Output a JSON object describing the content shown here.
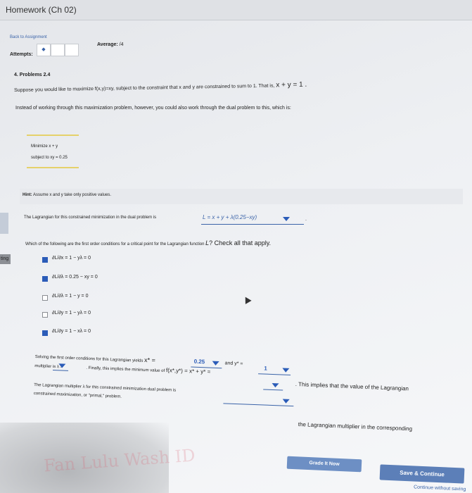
{
  "header": {
    "title": "Homework (Ch 02)"
  },
  "nav": {
    "back_link": "Back to Assignment"
  },
  "attempts": {
    "label": "Attempts:",
    "first_box": "◆"
  },
  "average": {
    "label": "Average:",
    "value": "/4"
  },
  "problem": {
    "number_label": "4. Problems 2.4",
    "statement_pre": "Suppose you would like to maximize f(x,y)=xy, subject to the constraint that x and y are constrained to sum to 1. That is,",
    "statement_eq": "x + y = 1 .",
    "dual_intro": "Instead of working through this maximization problem, however, you could also work through the dual problem to this, which is:"
  },
  "dual_box": {
    "line1": "Minimize x + y",
    "line2": "subject to xy = 0.25"
  },
  "hint": {
    "label": "Hint:",
    "text": "Assume x and y take only positive values."
  },
  "lagrangian": {
    "prompt": "The Lagrangian for this constrained minimization in the dual problem is",
    "selected": "L = x + y + λ(0.25−xy)",
    "suffix": "."
  },
  "foc": {
    "question_pre": "Which of the following are the first order conditions for a critical point for the Lagrangian function",
    "question_fn": "L",
    "question_post": "? Check all that apply.",
    "options": [
      {
        "text": "∂L/∂x = 1 − yλ = 0",
        "checked": true
      },
      {
        "text": "∂L/∂λ = 0.25 − xy = 0",
        "checked": true
      },
      {
        "text": "∂L/∂λ = 1 − y = 0",
        "checked": false
      },
      {
        "text": "∂L/∂y = 1 − yλ = 0",
        "checked": false
      },
      {
        "text": "∂L/∂y = 1 − xλ = 0",
        "checked": true
      }
    ]
  },
  "solution": {
    "line1_pre": "Solving the first order conditions for this Lagrangian yields",
    "x_star_label": "x* =",
    "x_star_value": "0.25",
    "y_star_label": "and y* =",
    "y_star_value": "1",
    "line2_pre": "multiplier is λ =",
    "line2_mid": ". Finally, this implies the minimum value of",
    "line2_fn": "f(x*,y*) = x* + y* =",
    "implies_text": ". This implies that the value of the Lagrangian",
    "line3": "The Lagrangian multiplier λ for this constrained minimization dual problem is",
    "line4": "constrained maximization, or \"primal,\" problem.",
    "corresponding_text": "the Lagrangian multiplier in the corresponding"
  },
  "buttons": {
    "grade": "Grade It Now",
    "save": "Save & Continue",
    "continue": "Continue without saving"
  },
  "side": {
    "label": "ting"
  },
  "colors": {
    "accent": "#2b5cb8",
    "button": "#5c7fb8",
    "background": "#eef0f3"
  },
  "watermark": "Fan Lulu Wash ID"
}
